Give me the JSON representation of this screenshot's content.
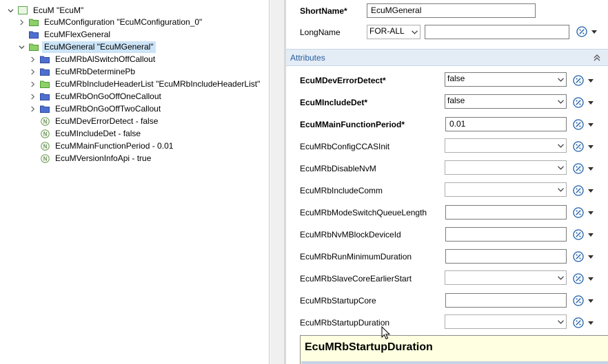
{
  "tree": {
    "root": "EcuM \"EcuM\"",
    "items": [
      {
        "label": "EcuMConfiguration \"EcuMConfiguration_0\"",
        "icon": "folder-green-icon"
      },
      {
        "label": "EcuMFlexGeneral",
        "icon": "folder-blue-icon"
      },
      {
        "label": "EcuMGeneral \"EcuMGeneral\"",
        "icon": "folder-green-icon"
      },
      {
        "label": "EcuMRbAlSwitchOffCallout",
        "icon": "folder-blue-icon"
      },
      {
        "label": "EcuMRbDeterminePb",
        "icon": "folder-blue-icon"
      },
      {
        "label": "EcuMRbIncludeHeaderList \"EcuMRbIncludeHeaderList\"",
        "icon": "folder-green-icon"
      },
      {
        "label": "EcuMRbOnGoOffOneCallout",
        "icon": "folder-blue-icon"
      },
      {
        "label": "EcuMRbOnGoOffTwoCallout",
        "icon": "folder-blue-icon"
      },
      {
        "label": "EcuMDevErrorDetect - false",
        "icon": "parameter-n-icon"
      },
      {
        "label": "EcuMIncludeDet - false",
        "icon": "parameter-n-icon"
      },
      {
        "label": "EcuMMainFunctionPeriod - 0.01",
        "icon": "parameter-n-icon"
      },
      {
        "label": "EcuMVersionInfoApi - true",
        "icon": "parameter-n-icon"
      }
    ]
  },
  "header": {
    "shortname_label": "ShortName*",
    "shortname_value": "EcuMGeneral",
    "longname_label": "LongName",
    "longname_lang": "FOR-ALL",
    "longname_value": ""
  },
  "attributes": {
    "title": "Attributes",
    "rows": [
      {
        "label": "EcuMDevErrorDetect*",
        "value": "false"
      },
      {
        "label": "EcuMIncludeDet*",
        "value": "false"
      },
      {
        "label": "EcuMMainFunctionPeriod*",
        "value": "0.01"
      },
      {
        "label": "EcuMRbConfigCCASInit",
        "value": ""
      },
      {
        "label": "EcuMRbDisableNvM",
        "value": ""
      },
      {
        "label": "EcuMRbIncludeComm",
        "value": ""
      },
      {
        "label": "EcuMRbModeSwitchQueueLength",
        "value": ""
      },
      {
        "label": "EcuMRbNvMBlockDeviceId",
        "value": ""
      },
      {
        "label": "EcuMRbRunMinimumDuration",
        "value": ""
      },
      {
        "label": "EcuMRbSlaveCoreEarlierStart",
        "value": ""
      },
      {
        "label": "EcuMRbStartupCore",
        "value": ""
      },
      {
        "label": "EcuMRbStartupDuration",
        "value": ""
      }
    ]
  },
  "tooltip": {
    "title": "EcuMRbStartupDuration"
  },
  "colors": {
    "selection": "#cce4f7",
    "attr_header_bg": "#e4ecf6",
    "attr_header_text": "#2a5d9f",
    "tooltip_bg": "#ffffe1",
    "action_icon": "#1f5fa8"
  }
}
